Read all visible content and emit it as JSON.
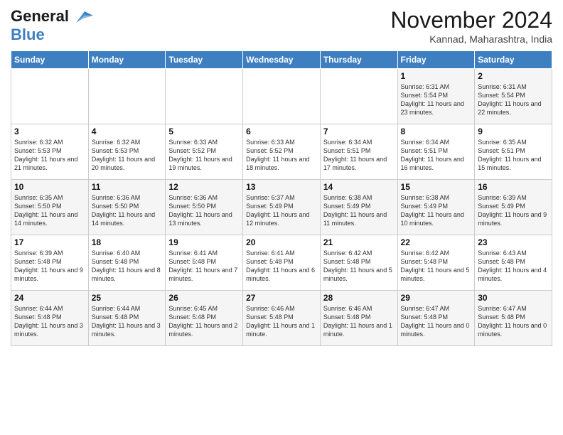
{
  "logo": {
    "line1": "General",
    "line2": "Blue",
    "icon": "▶"
  },
  "title": "November 2024",
  "subtitle": "Kannad, Maharashtra, India",
  "days_of_week": [
    "Sunday",
    "Monday",
    "Tuesday",
    "Wednesday",
    "Thursday",
    "Friday",
    "Saturday"
  ],
  "weeks": [
    [
      {
        "num": "",
        "info": ""
      },
      {
        "num": "",
        "info": ""
      },
      {
        "num": "",
        "info": ""
      },
      {
        "num": "",
        "info": ""
      },
      {
        "num": "",
        "info": ""
      },
      {
        "num": "1",
        "info": "Sunrise: 6:31 AM\nSunset: 5:54 PM\nDaylight: 11 hours and 23 minutes."
      },
      {
        "num": "2",
        "info": "Sunrise: 6:31 AM\nSunset: 5:54 PM\nDaylight: 11 hours and 22 minutes."
      }
    ],
    [
      {
        "num": "3",
        "info": "Sunrise: 6:32 AM\nSunset: 5:53 PM\nDaylight: 11 hours and 21 minutes."
      },
      {
        "num": "4",
        "info": "Sunrise: 6:32 AM\nSunset: 5:53 PM\nDaylight: 11 hours and 20 minutes."
      },
      {
        "num": "5",
        "info": "Sunrise: 6:33 AM\nSunset: 5:52 PM\nDaylight: 11 hours and 19 minutes."
      },
      {
        "num": "6",
        "info": "Sunrise: 6:33 AM\nSunset: 5:52 PM\nDaylight: 11 hours and 18 minutes."
      },
      {
        "num": "7",
        "info": "Sunrise: 6:34 AM\nSunset: 5:51 PM\nDaylight: 11 hours and 17 minutes."
      },
      {
        "num": "8",
        "info": "Sunrise: 6:34 AM\nSunset: 5:51 PM\nDaylight: 11 hours and 16 minutes."
      },
      {
        "num": "9",
        "info": "Sunrise: 6:35 AM\nSunset: 5:51 PM\nDaylight: 11 hours and 15 minutes."
      }
    ],
    [
      {
        "num": "10",
        "info": "Sunrise: 6:35 AM\nSunset: 5:50 PM\nDaylight: 11 hours and 14 minutes."
      },
      {
        "num": "11",
        "info": "Sunrise: 6:36 AM\nSunset: 5:50 PM\nDaylight: 11 hours and 14 minutes."
      },
      {
        "num": "12",
        "info": "Sunrise: 6:36 AM\nSunset: 5:50 PM\nDaylight: 11 hours and 13 minutes."
      },
      {
        "num": "13",
        "info": "Sunrise: 6:37 AM\nSunset: 5:49 PM\nDaylight: 11 hours and 12 minutes."
      },
      {
        "num": "14",
        "info": "Sunrise: 6:38 AM\nSunset: 5:49 PM\nDaylight: 11 hours and 11 minutes."
      },
      {
        "num": "15",
        "info": "Sunrise: 6:38 AM\nSunset: 5:49 PM\nDaylight: 11 hours and 10 minutes."
      },
      {
        "num": "16",
        "info": "Sunrise: 6:39 AM\nSunset: 5:49 PM\nDaylight: 11 hours and 9 minutes."
      }
    ],
    [
      {
        "num": "17",
        "info": "Sunrise: 6:39 AM\nSunset: 5:48 PM\nDaylight: 11 hours and 9 minutes."
      },
      {
        "num": "18",
        "info": "Sunrise: 6:40 AM\nSunset: 5:48 PM\nDaylight: 11 hours and 8 minutes."
      },
      {
        "num": "19",
        "info": "Sunrise: 6:41 AM\nSunset: 5:48 PM\nDaylight: 11 hours and 7 minutes."
      },
      {
        "num": "20",
        "info": "Sunrise: 6:41 AM\nSunset: 5:48 PM\nDaylight: 11 hours and 6 minutes."
      },
      {
        "num": "21",
        "info": "Sunrise: 6:42 AM\nSunset: 5:48 PM\nDaylight: 11 hours and 5 minutes."
      },
      {
        "num": "22",
        "info": "Sunrise: 6:42 AM\nSunset: 5:48 PM\nDaylight: 11 hours and 5 minutes."
      },
      {
        "num": "23",
        "info": "Sunrise: 6:43 AM\nSunset: 5:48 PM\nDaylight: 11 hours and 4 minutes."
      }
    ],
    [
      {
        "num": "24",
        "info": "Sunrise: 6:44 AM\nSunset: 5:48 PM\nDaylight: 11 hours and 3 minutes."
      },
      {
        "num": "25",
        "info": "Sunrise: 6:44 AM\nSunset: 5:48 PM\nDaylight: 11 hours and 3 minutes."
      },
      {
        "num": "26",
        "info": "Sunrise: 6:45 AM\nSunset: 5:48 PM\nDaylight: 11 hours and 2 minutes."
      },
      {
        "num": "27",
        "info": "Sunrise: 6:46 AM\nSunset: 5:48 PM\nDaylight: 11 hours and 1 minute."
      },
      {
        "num": "28",
        "info": "Sunrise: 6:46 AM\nSunset: 5:48 PM\nDaylight: 11 hours and 1 minute."
      },
      {
        "num": "29",
        "info": "Sunrise: 6:47 AM\nSunset: 5:48 PM\nDaylight: 11 hours and 0 minutes."
      },
      {
        "num": "30",
        "info": "Sunrise: 6:47 AM\nSunset: 5:48 PM\nDaylight: 11 hours and 0 minutes."
      }
    ]
  ]
}
